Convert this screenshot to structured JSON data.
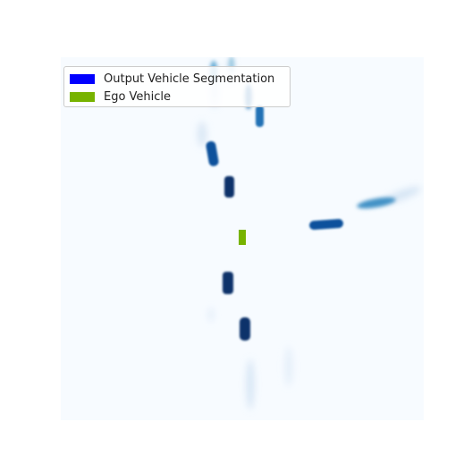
{
  "colors": {
    "background": "#f7fbff",
    "segmentation_swatch": "#0000ff",
    "segmentation_dark": "#08306b",
    "segmentation_mid": "#2171b5",
    "segmentation_light": "#6baed6",
    "ego_vehicle": "#77b300"
  },
  "legend": {
    "items": [
      {
        "label": "Output Vehicle Segmentation",
        "color": "#0000ff"
      },
      {
        "label": "Ego Vehicle",
        "color": "#77b300"
      }
    ]
  }
}
